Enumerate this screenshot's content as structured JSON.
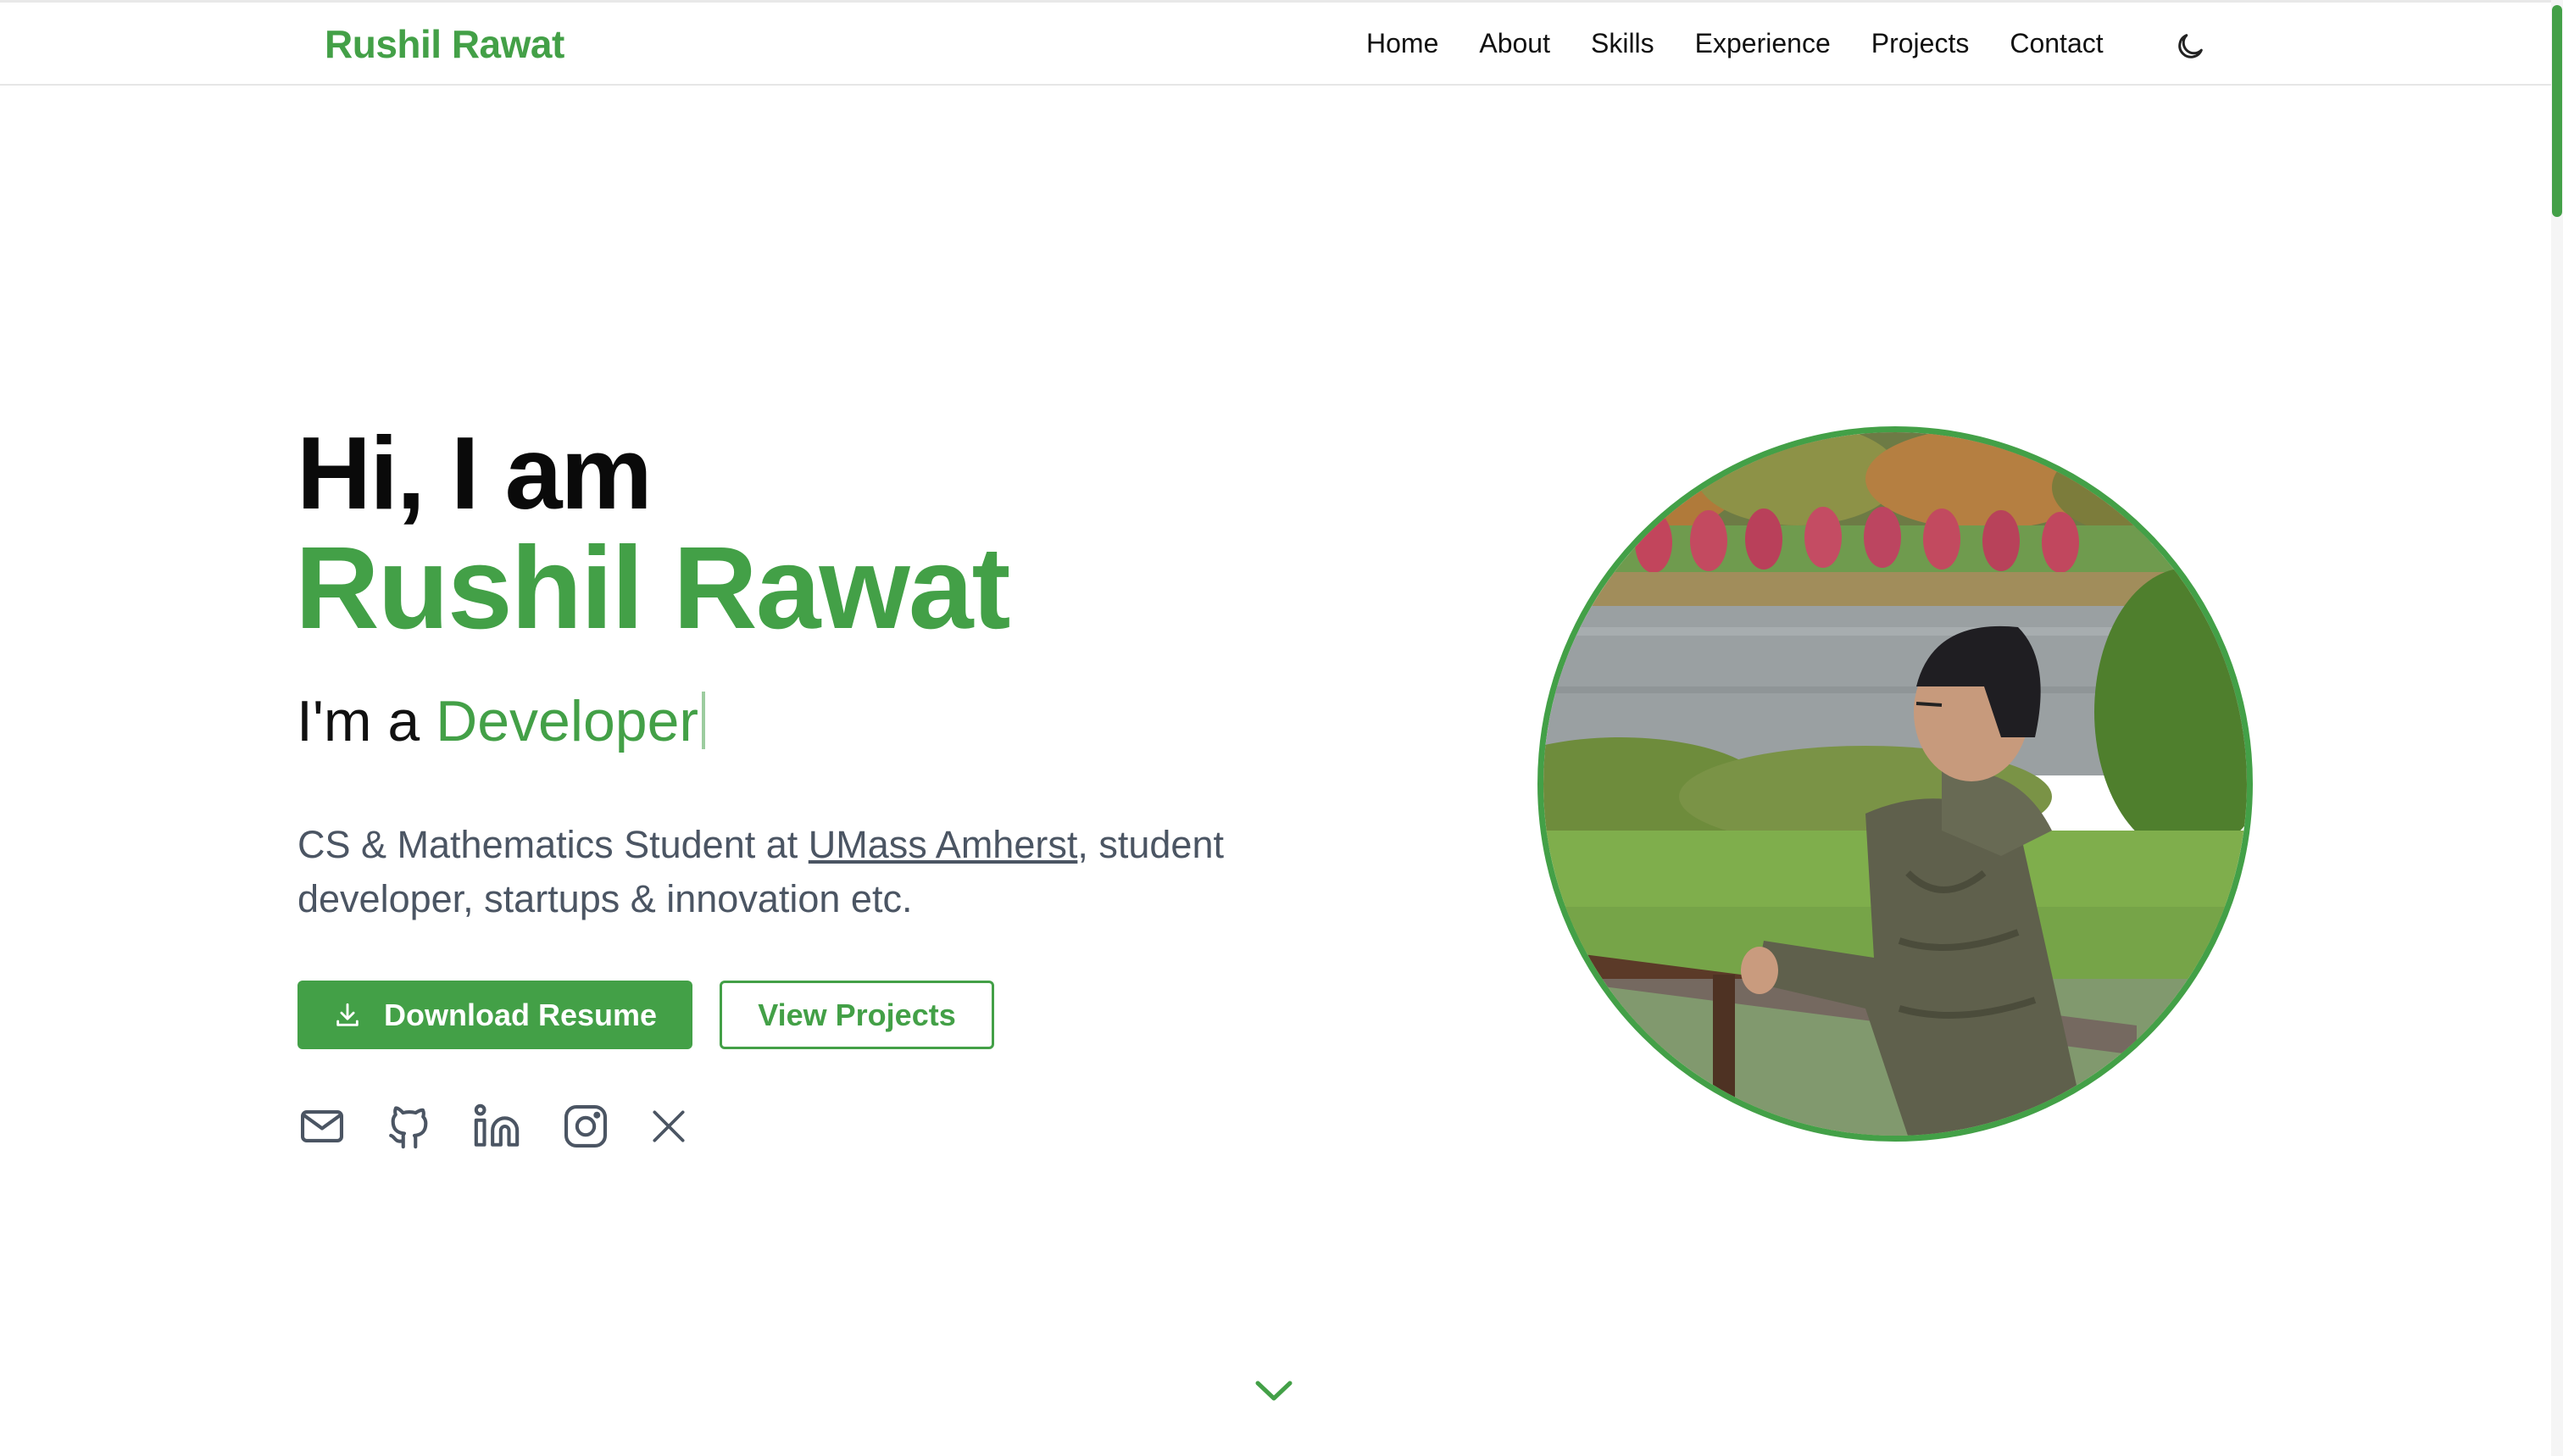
{
  "brand": "Rushil Rawat",
  "nav": {
    "links": [
      "Home",
      "About",
      "Skills",
      "Experience",
      "Projects",
      "Contact"
    ],
    "theme_toggle_icon": "moon-icon"
  },
  "hero": {
    "greeting": "Hi, I am",
    "name": "Rushil Rawat",
    "role_prefix": "I'm a ",
    "role_typed": "Developer",
    "description_before": "CS & Mathematics Student at ",
    "description_link": "UMass Amherst",
    "description_after": ", student developer, startups & innovation etc.",
    "primary_button": "Download Resume",
    "primary_button_icon": "download-icon",
    "secondary_button": "View Projects"
  },
  "social_icons": [
    "mail-icon",
    "github-icon",
    "linkedin-icon",
    "instagram-icon",
    "x-icon"
  ],
  "scroll_indicator_icon": "chevron-down-icon",
  "colors": {
    "accent": "#43a047",
    "text_dark": "#0a0a0a",
    "text_muted": "#4b5563"
  }
}
